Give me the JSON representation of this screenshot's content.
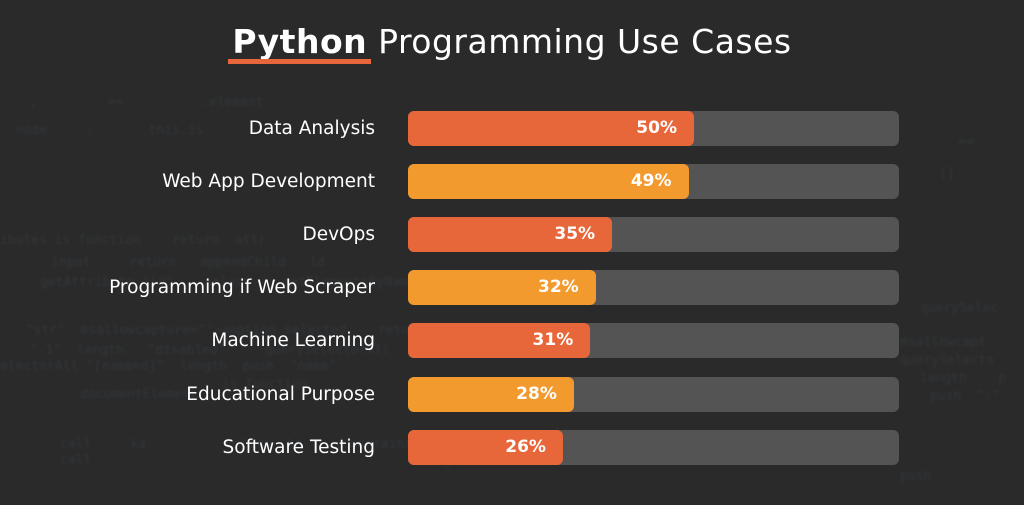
{
  "chart_data": {
    "type": "bar",
    "orientation": "horizontal",
    "title": "Python Programming Use Cases",
    "title_highlight": "Python",
    "title_rest": "Programming Use Cases",
    "xlabel": "",
    "ylabel": "",
    "unit": "%",
    "categories": [
      "Data Analysis",
      "Web App Development",
      "DevOps",
      "Programming if Web Scraper",
      "Machine Learning",
      "Educational Purpose",
      "Software Testing"
    ],
    "values": [
      50,
      49,
      35,
      32,
      31,
      28,
      26
    ],
    "value_labels": [
      "50%",
      "49%",
      "35%",
      "32%",
      "31%",
      "28%",
      "26%"
    ],
    "bar_colors": [
      "#e8673a",
      "#f29a2e",
      "#e8673a",
      "#f29a2e",
      "#e8673a",
      "#f29a2e",
      "#e8673a"
    ],
    "track_color": "#545454",
    "grid": false,
    "legend": "none"
  },
  "colors": {
    "background": "#2a2a2a",
    "accent": "#e8673a",
    "secondary": "#f29a2e",
    "text": "#ffffff"
  }
}
